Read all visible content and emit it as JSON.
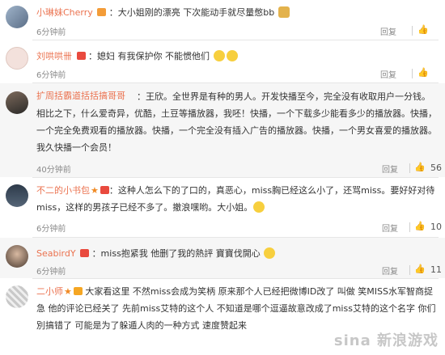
{
  "comments": [
    {
      "user": "小琳妹Cherry",
      "text": "：大小姐刚的漂亮 下次能动手就尽量憋bb",
      "time": "6分钟前",
      "reply": "回复"
    },
    {
      "user": "刘哄哄卌",
      "text": "：媳妇 有我保护你 不能惯他们",
      "time": "6分钟前",
      "reply": "回复"
    },
    {
      "user": "扩周括霸道括括搞哥哥",
      "text": "：王欣。全世界是有种的男人。开发快播至今，完全没有收取用户一分钱。相比之下，什么爱奇异，优酷，土豆等播放器，我呸！快播，一个下载多少能看多少的播放器。快播，一个完全免费观看的播放器。快播，一个完全没有插入广告的播放器。快播，一个男女喜爱的播放器。我久快播一个会员！",
      "time": "40分钟前",
      "reply": "回复",
      "likes": "56"
    },
    {
      "user": "不二的小书包",
      "text": "：这种人怎么下的了口的，真恶心，miss胸已经这么小了，还骂miss。要好好对待miss，这样的男孩子已经不多了。撤浪嘿哟。大小姐。",
      "time": "6分钟前",
      "reply": "回复",
      "likes": "10"
    },
    {
      "user": "SeabirdY",
      "text": "：miss抱紧我 他删了我的熱評 寶寶伐開心",
      "time": "6分钟前",
      "reply": "回复",
      "likes": "11"
    },
    {
      "user": "二小师",
      "text": "大家看这里 不然miss会成为笑柄 原来那个人已经把微博ID改了 叫做 笑MISS水军智商捉急 他的评论已经关了 先前miss艾特的这个人 不知道是哪个逗逼故意改成了miss艾特的这个名字 你们別搞错了 可能是为了躲遁人肉的一种方式 速度赞起来"
    }
  ],
  "watermark": "sina 新浪游戏"
}
